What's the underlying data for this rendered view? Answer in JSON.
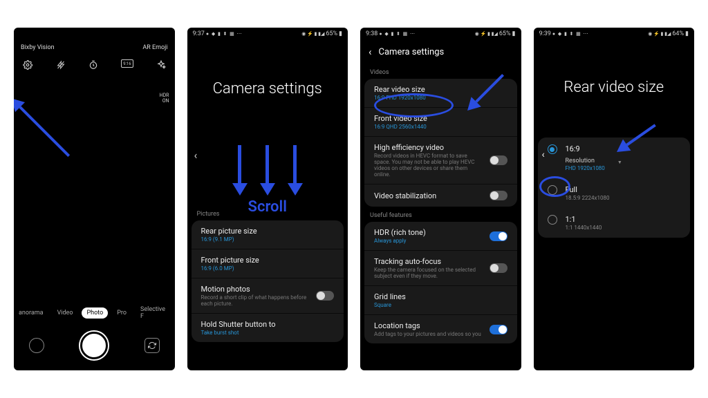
{
  "screen1": {
    "top_left": "Bixby Vision",
    "top_right": "AR Emoji",
    "hdr": "HDR",
    "hdr_on": "ON",
    "modes": [
      "anorama",
      "Video",
      "Photo",
      "Pro",
      "Selective F"
    ]
  },
  "screen2": {
    "status_time": "9:37",
    "status_batt": "65%",
    "title": "Camera settings",
    "scroll_label": "Scroll",
    "section": "Pictures",
    "items": [
      {
        "title": "Rear picture size",
        "sub": "16:9 (9.1 MP)"
      },
      {
        "title": "Front picture size",
        "sub": "16:9 (6.0 MP)"
      },
      {
        "title": "Motion photos",
        "sub": "Record a short clip of what happens before each picture.",
        "toggle": false
      },
      {
        "title": "Hold Shutter button to",
        "sub": "Take burst shot"
      }
    ]
  },
  "screen3": {
    "status_time": "9:38",
    "status_batt": "65%",
    "title": "Camera settings",
    "section1": "Videos",
    "items1": [
      {
        "title": "Rear video size",
        "sub": "16:9 FHD 1920x1080"
      },
      {
        "title": "Front video size",
        "sub": "16:9 QHD 2560x1440"
      },
      {
        "title": "High efficiency video",
        "sub": "Record videos in HEVC format to save space. You may not be able to play HEVC videos on other devices or share them online.",
        "toggle": false
      },
      {
        "title": "Video stabilization",
        "toggle": false
      }
    ],
    "section2": "Useful features",
    "items2": [
      {
        "title": "HDR (rich tone)",
        "sub": "Always apply",
        "toggle": true
      },
      {
        "title": "Tracking auto-focus",
        "sub": "Keep the camera focused on the selected subject even if they move.",
        "toggle": false
      },
      {
        "title": "Grid lines",
        "sub": "Square"
      },
      {
        "title": "Location tags",
        "sub": "Add tags to your pictures and videos so you",
        "toggle": true
      }
    ]
  },
  "screen4": {
    "status_time": "9:39",
    "status_batt": "64%",
    "title": "Rear video size",
    "options": [
      {
        "label": "16:9",
        "res_label": "Resolution",
        "res": "FHD 1920x1080",
        "selected": true
      },
      {
        "label": "Full",
        "sub": "18.5:9 2224x1080"
      },
      {
        "label": "1:1",
        "sub": "1:1 1440x1440"
      }
    ]
  }
}
